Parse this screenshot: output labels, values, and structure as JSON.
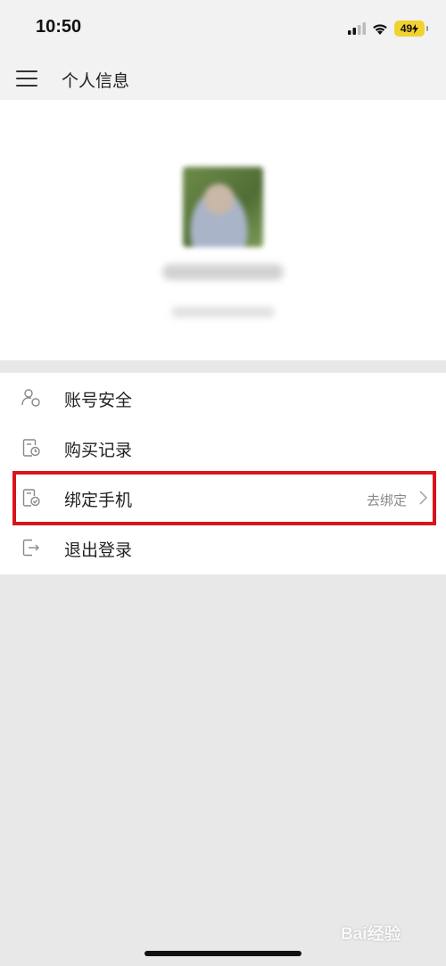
{
  "status_bar": {
    "time": "10:50",
    "battery": "49"
  },
  "header": {
    "title": "个人信息",
    "menu_icon": "hamburger-menu-icon"
  },
  "profile": {
    "avatar_icon": "user-avatar"
  },
  "menu": {
    "items": [
      {
        "label": "账号安全",
        "icon": "user-security-icon",
        "value": ""
      },
      {
        "label": "购买记录",
        "icon": "purchase-record-icon",
        "value": ""
      },
      {
        "label": "绑定手机",
        "icon": "bind-phone-icon",
        "value": "去绑定"
      },
      {
        "label": "退出登录",
        "icon": "logout-icon",
        "value": ""
      }
    ]
  },
  "highlight_color": "#d9151b",
  "watermark": {
    "text": "Bai经验"
  }
}
